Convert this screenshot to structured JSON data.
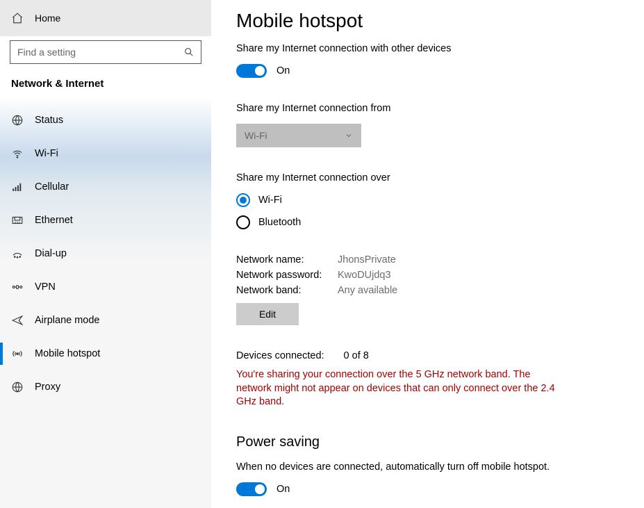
{
  "sidebar": {
    "home_label": "Home",
    "search_placeholder": "Find a setting",
    "category": "Network & Internet",
    "items": [
      {
        "id": "status",
        "label": "Status"
      },
      {
        "id": "wifi",
        "label": "Wi-Fi"
      },
      {
        "id": "cellular",
        "label": "Cellular"
      },
      {
        "id": "ethernet",
        "label": "Ethernet"
      },
      {
        "id": "dialup",
        "label": "Dial-up"
      },
      {
        "id": "vpn",
        "label": "VPN"
      },
      {
        "id": "airplane",
        "label": "Airplane mode"
      },
      {
        "id": "mobile-hotspot",
        "label": "Mobile hotspot"
      },
      {
        "id": "proxy",
        "label": "Proxy"
      }
    ],
    "selected_id": "mobile-hotspot"
  },
  "main": {
    "title": "Mobile hotspot",
    "share_with_devices_label": "Share my Internet connection with other devices",
    "share_toggle": {
      "on": true,
      "state_label": "On"
    },
    "share_from_label": "Share my Internet connection from",
    "share_from_value": "Wi-Fi",
    "share_over_label": "Share my Internet connection over",
    "share_over_options": [
      {
        "id": "wifi",
        "label": "Wi-Fi",
        "selected": true
      },
      {
        "id": "bluetooth",
        "label": "Bluetooth",
        "selected": false
      }
    ],
    "network": {
      "name_label": "Network name:",
      "name_value": "JhonsPrivate",
      "password_label": "Network password:",
      "password_value": "KwoDUjdq3",
      "band_label": "Network band:",
      "band_value": "Any available"
    },
    "edit_button_label": "Edit",
    "devices_connected_label": "Devices connected:",
    "devices_connected_value": "0 of 8",
    "warning_text": "You're sharing your connection over the 5 GHz network band. The network might not appear on devices that can only connect over the 2.4 GHz band.",
    "power_saving": {
      "heading": "Power saving",
      "description": "When no devices are connected, automatically turn off mobile hotspot.",
      "toggle": {
        "on": true,
        "state_label": "On"
      }
    }
  }
}
